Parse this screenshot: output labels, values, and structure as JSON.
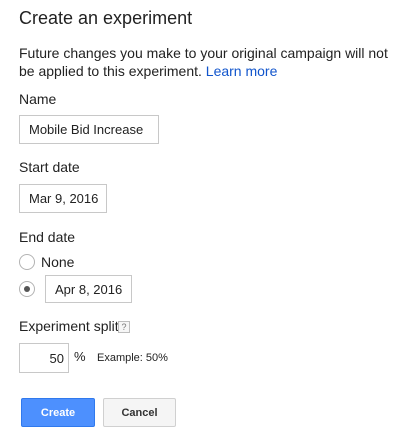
{
  "dialog": {
    "title": "Create an experiment",
    "description": "Future changes you make to your original campaign will not be applied to this experiment.",
    "learn_more": "Learn more"
  },
  "name": {
    "label": "Name",
    "value": "Mobile Bid Increase"
  },
  "start_date": {
    "label": "Start date",
    "value": "Mar 9, 2016"
  },
  "end_date": {
    "label": "End date",
    "options": [
      {
        "label": "None",
        "selected": false
      },
      {
        "value": "Apr 8, 2016",
        "selected": true
      }
    ]
  },
  "split": {
    "label": "Experiment split",
    "help_icon": "?",
    "value": "50",
    "unit": "%",
    "example": "Example: 50%"
  },
  "actions": {
    "create": "Create",
    "cancel": "Cancel"
  },
  "colors": {
    "primary_button": "#4d90fe",
    "link": "#1155cc"
  }
}
